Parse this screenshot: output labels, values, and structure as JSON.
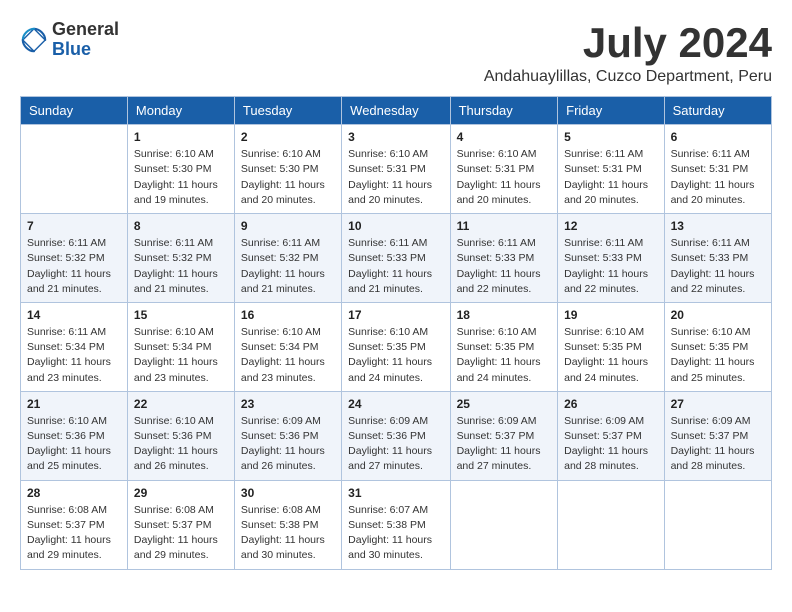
{
  "header": {
    "logo_line1": "General",
    "logo_line2": "Blue",
    "month": "July 2024",
    "location": "Andahuaylillas, Cuzco Department, Peru"
  },
  "weekdays": [
    "Sunday",
    "Monday",
    "Tuesday",
    "Wednesday",
    "Thursday",
    "Friday",
    "Saturday"
  ],
  "weeks": [
    [
      {
        "day": "",
        "info": ""
      },
      {
        "day": "1",
        "info": "Sunrise: 6:10 AM\nSunset: 5:30 PM\nDaylight: 11 hours\nand 19 minutes."
      },
      {
        "day": "2",
        "info": "Sunrise: 6:10 AM\nSunset: 5:30 PM\nDaylight: 11 hours\nand 20 minutes."
      },
      {
        "day": "3",
        "info": "Sunrise: 6:10 AM\nSunset: 5:31 PM\nDaylight: 11 hours\nand 20 minutes."
      },
      {
        "day": "4",
        "info": "Sunrise: 6:10 AM\nSunset: 5:31 PM\nDaylight: 11 hours\nand 20 minutes."
      },
      {
        "day": "5",
        "info": "Sunrise: 6:11 AM\nSunset: 5:31 PM\nDaylight: 11 hours\nand 20 minutes."
      },
      {
        "day": "6",
        "info": "Sunrise: 6:11 AM\nSunset: 5:31 PM\nDaylight: 11 hours\nand 20 minutes."
      }
    ],
    [
      {
        "day": "7",
        "info": "Sunrise: 6:11 AM\nSunset: 5:32 PM\nDaylight: 11 hours\nand 21 minutes."
      },
      {
        "day": "8",
        "info": "Sunrise: 6:11 AM\nSunset: 5:32 PM\nDaylight: 11 hours\nand 21 minutes."
      },
      {
        "day": "9",
        "info": "Sunrise: 6:11 AM\nSunset: 5:32 PM\nDaylight: 11 hours\nand 21 minutes."
      },
      {
        "day": "10",
        "info": "Sunrise: 6:11 AM\nSunset: 5:33 PM\nDaylight: 11 hours\nand 21 minutes."
      },
      {
        "day": "11",
        "info": "Sunrise: 6:11 AM\nSunset: 5:33 PM\nDaylight: 11 hours\nand 22 minutes."
      },
      {
        "day": "12",
        "info": "Sunrise: 6:11 AM\nSunset: 5:33 PM\nDaylight: 11 hours\nand 22 minutes."
      },
      {
        "day": "13",
        "info": "Sunrise: 6:11 AM\nSunset: 5:33 PM\nDaylight: 11 hours\nand 22 minutes."
      }
    ],
    [
      {
        "day": "14",
        "info": "Sunrise: 6:11 AM\nSunset: 5:34 PM\nDaylight: 11 hours\nand 23 minutes."
      },
      {
        "day": "15",
        "info": "Sunrise: 6:10 AM\nSunset: 5:34 PM\nDaylight: 11 hours\nand 23 minutes."
      },
      {
        "day": "16",
        "info": "Sunrise: 6:10 AM\nSunset: 5:34 PM\nDaylight: 11 hours\nand 23 minutes."
      },
      {
        "day": "17",
        "info": "Sunrise: 6:10 AM\nSunset: 5:35 PM\nDaylight: 11 hours\nand 24 minutes."
      },
      {
        "day": "18",
        "info": "Sunrise: 6:10 AM\nSunset: 5:35 PM\nDaylight: 11 hours\nand 24 minutes."
      },
      {
        "day": "19",
        "info": "Sunrise: 6:10 AM\nSunset: 5:35 PM\nDaylight: 11 hours\nand 24 minutes."
      },
      {
        "day": "20",
        "info": "Sunrise: 6:10 AM\nSunset: 5:35 PM\nDaylight: 11 hours\nand 25 minutes."
      }
    ],
    [
      {
        "day": "21",
        "info": "Sunrise: 6:10 AM\nSunset: 5:36 PM\nDaylight: 11 hours\nand 25 minutes."
      },
      {
        "day": "22",
        "info": "Sunrise: 6:10 AM\nSunset: 5:36 PM\nDaylight: 11 hours\nand 26 minutes."
      },
      {
        "day": "23",
        "info": "Sunrise: 6:09 AM\nSunset: 5:36 PM\nDaylight: 11 hours\nand 26 minutes."
      },
      {
        "day": "24",
        "info": "Sunrise: 6:09 AM\nSunset: 5:36 PM\nDaylight: 11 hours\nand 27 minutes."
      },
      {
        "day": "25",
        "info": "Sunrise: 6:09 AM\nSunset: 5:37 PM\nDaylight: 11 hours\nand 27 minutes."
      },
      {
        "day": "26",
        "info": "Sunrise: 6:09 AM\nSunset: 5:37 PM\nDaylight: 11 hours\nand 28 minutes."
      },
      {
        "day": "27",
        "info": "Sunrise: 6:09 AM\nSunset: 5:37 PM\nDaylight: 11 hours\nand 28 minutes."
      }
    ],
    [
      {
        "day": "28",
        "info": "Sunrise: 6:08 AM\nSunset: 5:37 PM\nDaylight: 11 hours\nand 29 minutes."
      },
      {
        "day": "29",
        "info": "Sunrise: 6:08 AM\nSunset: 5:37 PM\nDaylight: 11 hours\nand 29 minutes."
      },
      {
        "day": "30",
        "info": "Sunrise: 6:08 AM\nSunset: 5:38 PM\nDaylight: 11 hours\nand 30 minutes."
      },
      {
        "day": "31",
        "info": "Sunrise: 6:07 AM\nSunset: 5:38 PM\nDaylight: 11 hours\nand 30 minutes."
      },
      {
        "day": "",
        "info": ""
      },
      {
        "day": "",
        "info": ""
      },
      {
        "day": "",
        "info": ""
      }
    ]
  ]
}
